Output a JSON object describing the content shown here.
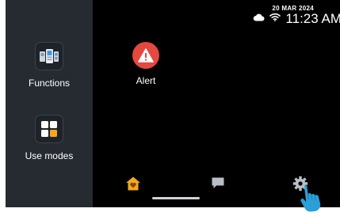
{
  "status_bar": {
    "date": "20 MAR 2024",
    "time": "11:23 AM",
    "icons": [
      "cloud-icon",
      "wifi-icon"
    ]
  },
  "sidebar": {
    "items": [
      {
        "label": "Functions",
        "icon": "intercom-devices-icon"
      },
      {
        "label": "Use modes",
        "icon": "grid-modes-icon"
      }
    ]
  },
  "main": {
    "apps": [
      {
        "label": "Alert",
        "icon": "warning-icon",
        "color": "#e5483f"
      }
    ]
  },
  "bottom_nav": {
    "items": [
      {
        "name": "home",
        "icon": "home-heart-icon",
        "active": true,
        "color": "#f5a623"
      },
      {
        "name": "messages",
        "icon": "message-icon",
        "active": false
      },
      {
        "name": "settings",
        "icon": "gear-icon",
        "active": false
      }
    ]
  },
  "colors": {
    "background": "#000000",
    "sidebar": "#262b31",
    "accent": "#f5a623",
    "alert": "#e5483f",
    "touch_hand": "#2a9fd8"
  }
}
